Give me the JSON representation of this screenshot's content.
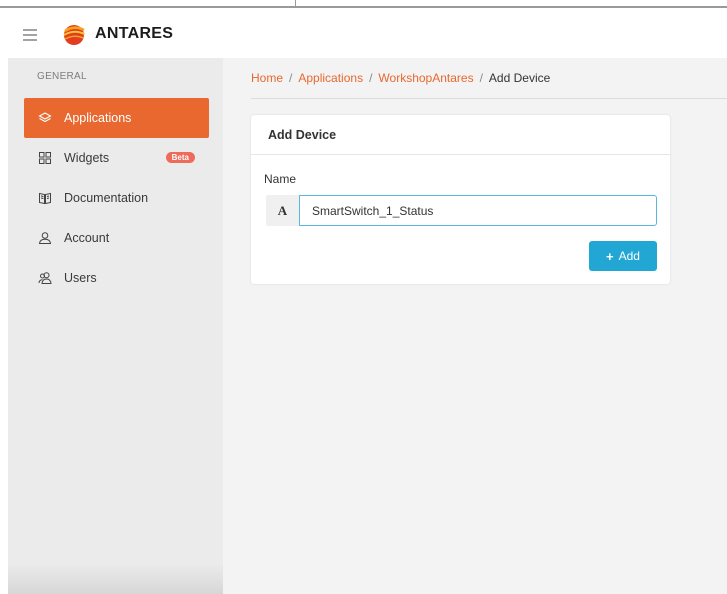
{
  "header": {
    "app_name": "ANTARES",
    "menu_icon": "hamburger-menu-icon",
    "logo_icon": "antares-logo-icon",
    "brand_color": "#e8682f"
  },
  "sidebar": {
    "section_label": "GENERAL",
    "items": [
      {
        "label": "Applications",
        "icon": "layers-icon",
        "active": true
      },
      {
        "label": "Widgets",
        "icon": "grid-icon",
        "badge": "Beta"
      },
      {
        "label": "Documentation",
        "icon": "book-icon"
      },
      {
        "label": "Account",
        "icon": "user-icon"
      },
      {
        "label": "Users",
        "icon": "users-icon"
      }
    ]
  },
  "breadcrumb": {
    "items": [
      "Home",
      "Applications",
      "WorkshopAntares"
    ],
    "separator": "/",
    "current": "Add Device"
  },
  "form": {
    "title": "Add Device",
    "name_label": "Name",
    "name_addon": "A",
    "name_value": "SmartSwitch_1_Status",
    "submit_label": "Add",
    "submit_icon": "plus-icon",
    "button_color": "#22a7d4"
  }
}
